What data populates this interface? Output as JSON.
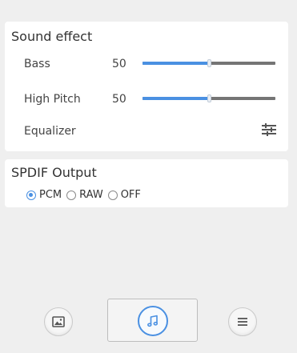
{
  "sound_effect": {
    "title": "Sound effect",
    "bass": {
      "label": "Bass",
      "value": "50",
      "level": 0.5
    },
    "high_pitch": {
      "label": "High Pitch",
      "value": "50",
      "level": 0.5
    },
    "equalizer": {
      "label": "Equalizer",
      "icon": "sliders-icon"
    }
  },
  "spdif": {
    "title": "SPDIF Output",
    "options": [
      "PCM",
      "RAW",
      "OFF"
    ],
    "selected": "PCM"
  },
  "bottom_bar": {
    "picture_icon": "picture-icon",
    "music_icon": "music-note-icon",
    "menu_icon": "menu-icon"
  },
  "colors": {
    "accent": "#4a90e2",
    "background": "#efefef",
    "panel": "#ffffff",
    "track": "#757575"
  }
}
